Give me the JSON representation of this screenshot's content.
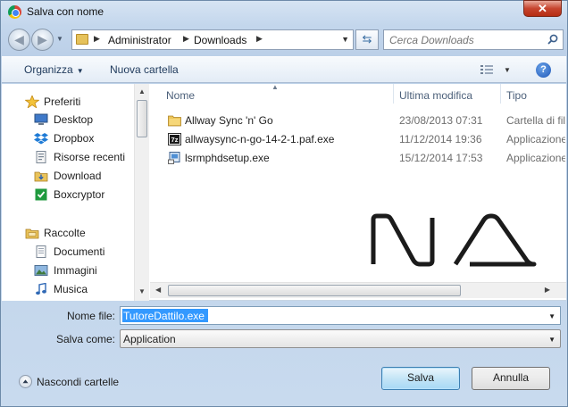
{
  "window": {
    "title": "Salva con nome",
    "close_label": "✕"
  },
  "navigation": {
    "back_icon": "back-arrow-icon",
    "forward_icon": "forward-arrow-icon",
    "breadcrumbs": [
      "Administrator",
      "Downloads"
    ],
    "search_placeholder": "Cerca Downloads"
  },
  "toolbar": {
    "organize_label": "Organizza",
    "new_folder_label": "Nuova cartella",
    "help_label": "?"
  },
  "sidebar": {
    "favorites": {
      "label": "Preferiti",
      "icon": "star-icon",
      "items": [
        {
          "label": "Desktop",
          "icon": "desktop-icon"
        },
        {
          "label": "Dropbox",
          "icon": "dropbox-icon"
        },
        {
          "label": "Risorse recenti",
          "icon": "recent-places-icon"
        },
        {
          "label": "Download",
          "icon": "download-folder-icon"
        },
        {
          "label": "Boxcryptor",
          "icon": "boxcryptor-icon"
        }
      ]
    },
    "libraries": {
      "label": "Raccolte",
      "icon": "libraries-icon",
      "items": [
        {
          "label": "Documenti",
          "icon": "documents-icon"
        },
        {
          "label": "Immagini",
          "icon": "pictures-icon"
        },
        {
          "label": "Musica",
          "icon": "music-icon"
        }
      ]
    }
  },
  "file_list": {
    "columns": [
      "Nome",
      "Ultima modifica",
      "Tipo"
    ],
    "rows": [
      {
        "name": "Allway Sync 'n' Go",
        "modified": "23/08/2013 07:31",
        "type": "Cartella di file",
        "icon": "folder-icon"
      },
      {
        "name": "allwaysync-n-go-14-2-1.paf.exe",
        "modified": "11/12/2014 19:36",
        "type": "Applicazione",
        "icon": "7z-exe-icon"
      },
      {
        "name": "lsrmphdsetup.exe",
        "modified": "15/12/2014 17:53",
        "type": "Applicazione",
        "icon": "setup-exe-icon"
      }
    ]
  },
  "form": {
    "filename_label": "Nome file:",
    "filename_value": "TutoreDattilo.exe",
    "savetype_label": "Salva come:",
    "savetype_value": "Application"
  },
  "footer": {
    "hide_folders_label": "Nascondi cartelle",
    "save_label": "Salva",
    "cancel_label": "Annulla"
  },
  "colors": {
    "selection": "#3399ff",
    "window_frame": "#c3d6ec",
    "close_button": "#c7452f"
  }
}
